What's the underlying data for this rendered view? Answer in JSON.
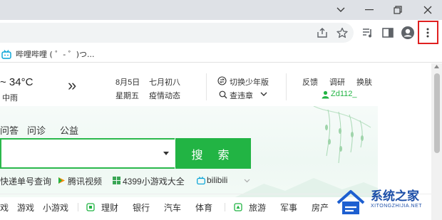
{
  "browser": {
    "bookmark_label": "哔哩哔哩 ( ゜- ゜)つ..."
  },
  "weather": {
    "temp": "~ 34°C",
    "condition": "中雨",
    "expand_glyph": "»"
  },
  "calendar": {
    "date": "8月5日",
    "weekday": "星期五",
    "lunar": "七月初八",
    "epidemic": "疫情动态"
  },
  "mode": {
    "youth": "切换少年版",
    "query": "查违章"
  },
  "links": {
    "feedback": "反馈",
    "survey": "调研",
    "skin": "换肤",
    "username": "Zd112_"
  },
  "search": {
    "tabs": [
      "问答",
      "问诊",
      "公益"
    ],
    "button_label": "搜 索"
  },
  "quick_links": [
    "快递单号查询",
    "腾讯视频",
    "4399小游戏大全",
    "bilibili"
  ],
  "nav": [
    "戏",
    "游戏",
    "小游戏",
    "理财",
    "银行",
    "汽车",
    "体育",
    "旅游",
    "军事",
    "房产"
  ],
  "watermark": {
    "name": "系统之家",
    "url": "XITONGZHIJIA.NET"
  },
  "colors": {
    "accent_green": "#22b444",
    "menu_highlight": "#e02020"
  }
}
